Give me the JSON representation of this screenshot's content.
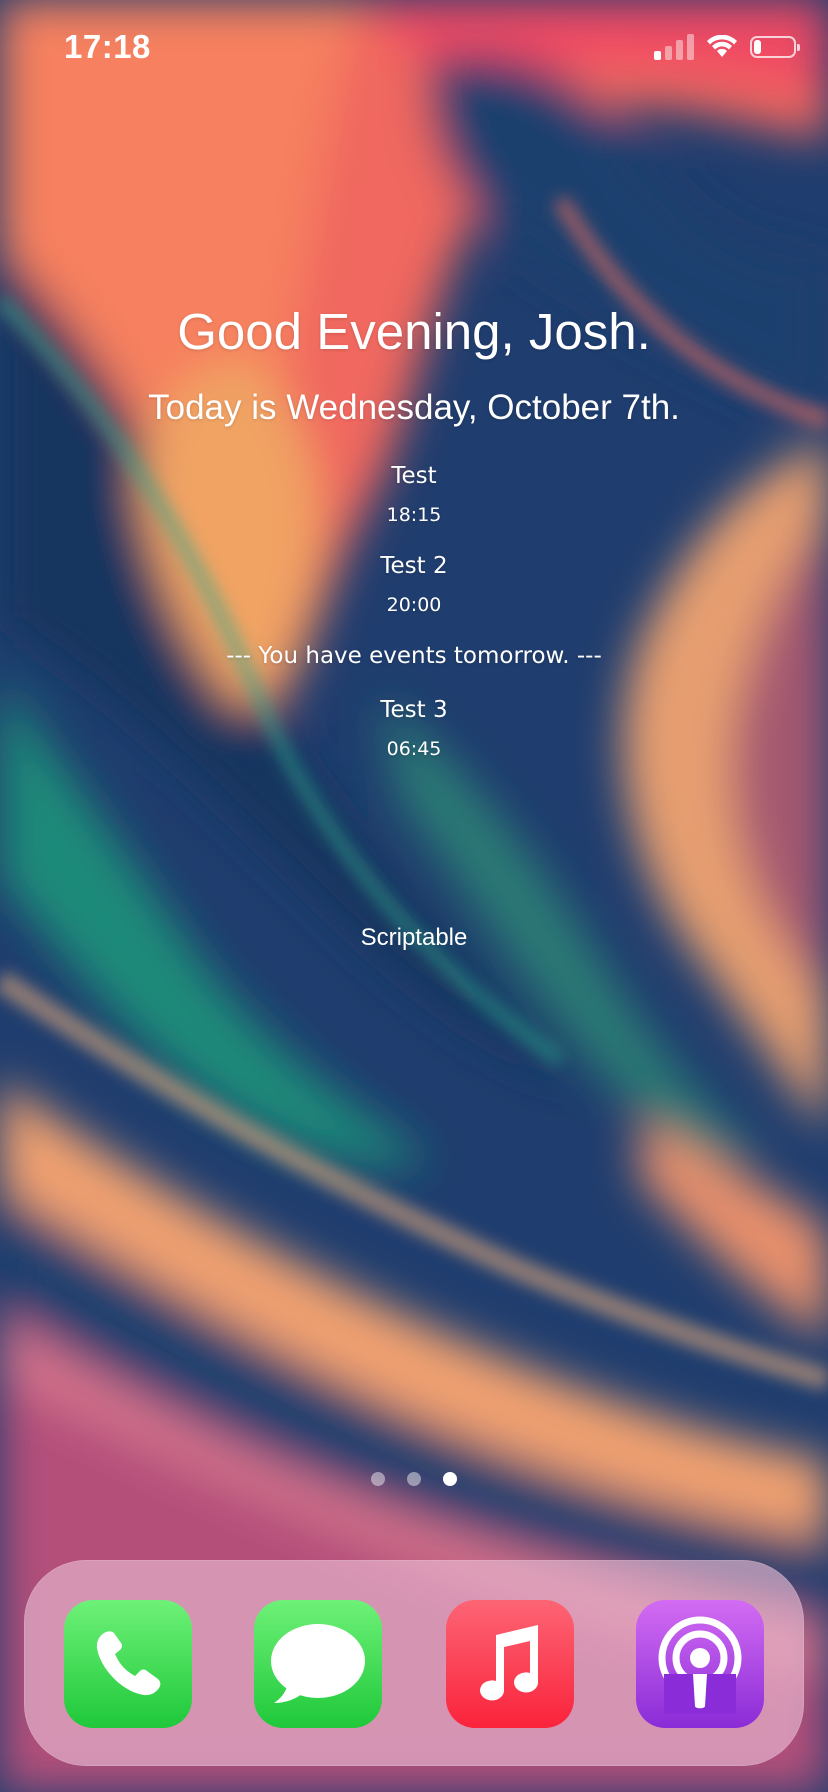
{
  "status_bar": {
    "time": "17:18",
    "signal_bars": 4,
    "signal_bars_active": 1,
    "battery_level": 0.2
  },
  "widget": {
    "greeting": "Good Evening, Josh.",
    "date_line": "Today is Wednesday, October 7th.",
    "events_today": [
      {
        "title": "Test",
        "time": "18:15"
      },
      {
        "title": "Test 2",
        "time": "20:00"
      }
    ],
    "tomorrow_note": "--- You have events tomorrow. ---",
    "events_tomorrow": [
      {
        "title": "Test 3",
        "time": "06:45"
      }
    ],
    "label": "Scriptable"
  },
  "page_dots": {
    "count": 3,
    "active_index": 2
  },
  "dock": {
    "apps": [
      {
        "name": "Phone",
        "icon": "phone-icon",
        "color": "#28cd41"
      },
      {
        "name": "Messages",
        "icon": "messages-icon",
        "color": "#28cd41"
      },
      {
        "name": "Music",
        "icon": "music-note-icon",
        "color": "#fa2d48"
      },
      {
        "name": "Podcasts",
        "icon": "podcasts-icon",
        "color": "#9b3fe0"
      }
    ]
  },
  "colors": {
    "text": "#ffffff",
    "dock_background": "#ebbed7"
  }
}
